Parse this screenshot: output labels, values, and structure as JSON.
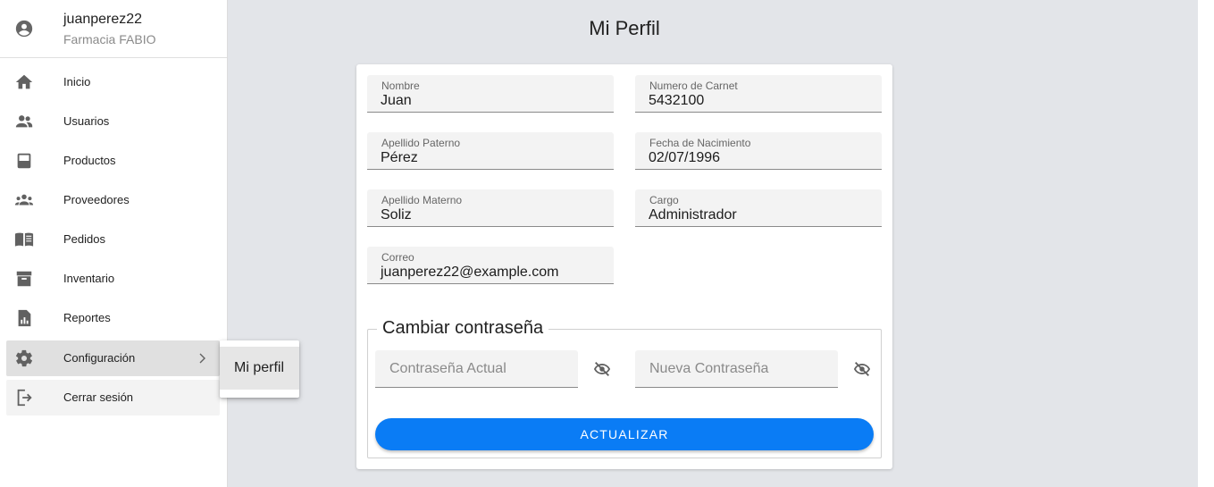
{
  "user": {
    "username": "juanperez22",
    "store": "Farmacia FABIO"
  },
  "sidebar": {
    "items": [
      {
        "label": "Inicio",
        "icon": "home-icon"
      },
      {
        "label": "Usuarios",
        "icon": "people-icon"
      },
      {
        "label": "Productos",
        "icon": "box-icon"
      },
      {
        "label": "Proveedores",
        "icon": "group-icon"
      },
      {
        "label": "Pedidos",
        "icon": "book-icon"
      },
      {
        "label": "Inventario",
        "icon": "archive-icon"
      },
      {
        "label": "Reportes",
        "icon": "report-icon"
      },
      {
        "label": "Configuración",
        "icon": "gear-icon"
      },
      {
        "label": "Cerrar sesión",
        "icon": "logout-icon"
      }
    ],
    "submenu": {
      "label": "Mi perfil"
    }
  },
  "page": {
    "title": "Mi Perfil"
  },
  "profile": {
    "nombre": {
      "label": "Nombre",
      "value": "Juan"
    },
    "carnet": {
      "label": "Numero de Carnet",
      "value": "5432100"
    },
    "paterno": {
      "label": "Apellido Paterno",
      "value": "Pérez"
    },
    "nacimiento": {
      "label": "Fecha de Nacimiento",
      "value": "02/07/1996"
    },
    "materno": {
      "label": "Apellido Materno",
      "value": "Soliz"
    },
    "cargo": {
      "label": "Cargo",
      "value": "Administrador"
    },
    "correo": {
      "label": "Correo",
      "value": "juanperez22@example.com"
    }
  },
  "password": {
    "legend": "Cambiar contraseña",
    "current_placeholder": "Contraseña Actual",
    "new_placeholder": "Nueva Contraseña",
    "update_label": "ACTUALIZAR"
  },
  "colors": {
    "accent": "#0a7cf5",
    "background": "#e3e5e9"
  }
}
